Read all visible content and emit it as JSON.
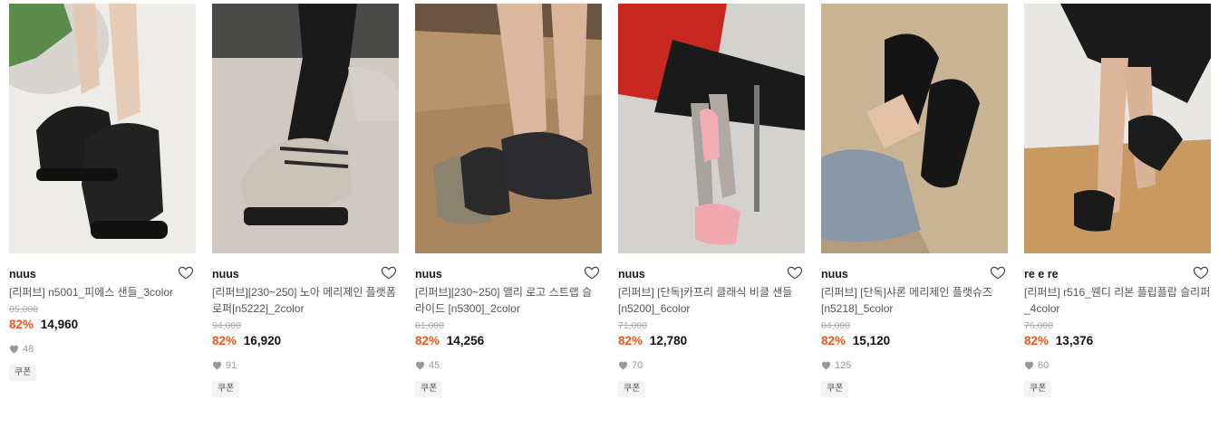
{
  "colors": {
    "discount": "#f1541f",
    "price": "#111111",
    "muted": "#999999"
  },
  "products": [
    {
      "brand": "nuus",
      "title": "[리퍼브] n5001_피에스 샌들_3color",
      "original_price": "85,000",
      "discount": "82%",
      "price": "14,960",
      "likes": "48",
      "badge": "쿠폰"
    },
    {
      "brand": "nuus",
      "title": "[리퍼브][230~250] 노아 메리제인 플랫폼 로퍼[n5222]_2color",
      "original_price": "94,000",
      "discount": "82%",
      "price": "16,920",
      "likes": "91",
      "badge": "쿠폰"
    },
    {
      "brand": "nuus",
      "title": "[리퍼브][230~250] 앨리 로고 스트랩 슬라이드 [n5300]_2color",
      "original_price": "81,000",
      "discount": "82%",
      "price": "14,256",
      "likes": "45",
      "badge": "쿠폰"
    },
    {
      "brand": "nuus",
      "title": "[리퍼브] [단독]카프리 클래식 비클 샌들[n5200]_6color",
      "original_price": "71,000",
      "discount": "82%",
      "price": "12,780",
      "likes": "70",
      "badge": "쿠폰"
    },
    {
      "brand": "nuus",
      "title": "[리퍼브] [단독]샤론 메리제인 플랫슈즈[n5218]_5color",
      "original_price": "84,000",
      "discount": "82%",
      "price": "15,120",
      "likes": "125",
      "badge": "쿠폰"
    },
    {
      "brand": "re e re",
      "title": "[리퍼브] r516_웬디 리본 플립플랍 슬리퍼_4color",
      "original_price": "76,000",
      "discount": "82%",
      "price": "13,376",
      "likes": "60",
      "badge": "쿠폰"
    }
  ]
}
